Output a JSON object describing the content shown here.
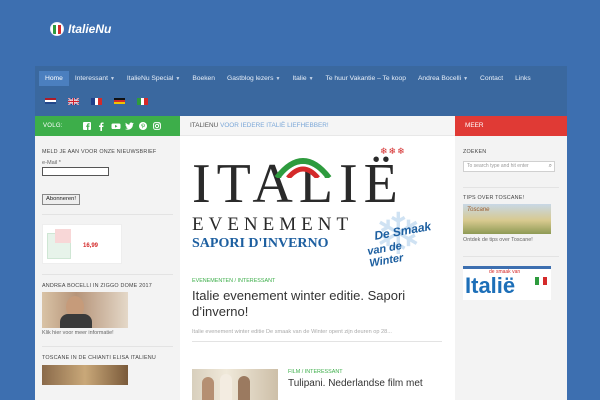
{
  "header": {
    "logo_text": "ItalieNu"
  },
  "nav": {
    "items": [
      {
        "label": "Home",
        "active": true,
        "dropdown": false
      },
      {
        "label": "Interessant",
        "dropdown": true
      },
      {
        "label": "ItalieNu Special",
        "dropdown": true
      },
      {
        "label": "Boeken",
        "dropdown": false
      },
      {
        "label": "Gastblog lezers",
        "dropdown": true
      },
      {
        "label": "Italie",
        "dropdown": true
      },
      {
        "label": "Te huur Vakantie – Te koop",
        "dropdown": false
      },
      {
        "label": "Andrea Bocelli",
        "dropdown": true
      },
      {
        "label": "Contact",
        "dropdown": false
      },
      {
        "label": "Links",
        "dropdown": false
      }
    ],
    "flags": [
      "nl",
      "uk",
      "fr",
      "de",
      "it"
    ]
  },
  "sidebar_left": {
    "follow_label": "VOLG:",
    "social_icons": [
      "facebook-square-icon",
      "facebook-icon",
      "youtube-icon",
      "twitter-icon",
      "pinterest-icon",
      "instagram-icon"
    ],
    "newsletter_heading": "MELD JE AAN VOOR ONZE NIEUWSBRIEF",
    "email_label": "e-Mail *",
    "subscribe_button": "Abonneren!",
    "price": "16,99",
    "bocelli_heading": "ANDREA BOCELLI IN ZIGGO DOME 2017",
    "bocelli_link": "Klik hier voor meer informatie!",
    "toscane_heading": "TOSCANE IN DE CHIANTI ELISA ITALIENU"
  },
  "main": {
    "bar_site": "ITALIENU",
    "bar_tag": " VOOR IEDERE ITALIË LIEFHEBBER!",
    "post1": {
      "logo_title": "ITALIË",
      "logo_sub": "EVENEMENT",
      "logo_sapori": "SAPORI D'INVERNO",
      "logo_badge_line1": "De Smaak",
      "logo_badge_line2": "van de Winter",
      "categories": "EVENEMENTEN / INTERESSANT",
      "title": "Italie evenement winter editie. Sapori d’inverno!",
      "excerpt": "Italie evenement winter editie De smaak van de Winter opent zijn deuren op 28..."
    },
    "post2": {
      "categories": "FILM / INTERESSANT",
      "title": "Tulipani. Nederlandse film met"
    }
  },
  "sidebar_right": {
    "meer_label": "MEER",
    "search_heading": "ZOEKEN",
    "search_placeholder": "To search type and hit enter",
    "tips_heading": "TIPS OVER TOSCANE!",
    "tips_link": "Ontdek de tips over Toscane!",
    "magazine_badge": "de smaak van",
    "magazine_title": "Italië"
  },
  "colors": {
    "brand_blue": "#3d6fb0",
    "nav_blue": "#3a689f",
    "green": "#3dae4a",
    "red": "#e03a35"
  }
}
